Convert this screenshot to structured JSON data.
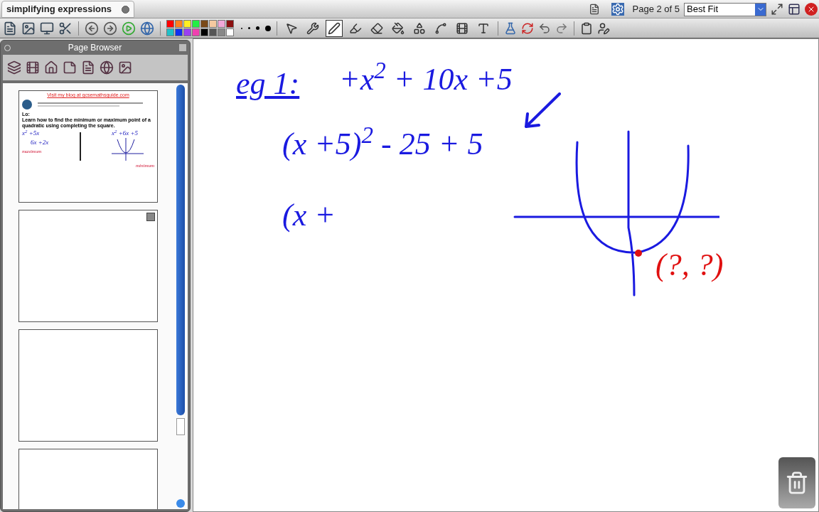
{
  "tab": {
    "title": "simplifying expressions"
  },
  "page_indicator": "Page 2 of 5",
  "zoom": {
    "value": "Best Fit"
  },
  "palette": [
    {
      "color": "#ff0000"
    },
    {
      "color": "#ff7f1e"
    },
    {
      "color": "#ffee22"
    },
    {
      "color": "#22ee44"
    },
    {
      "color": "#7a4a1a"
    },
    {
      "color": "#f5c9a0"
    },
    {
      "color": "#f0a8d8"
    },
    {
      "color": "#8b1010"
    },
    {
      "color": "#20c0c8"
    },
    {
      "color": "#1030f0"
    },
    {
      "color": "#9a40f0"
    },
    {
      "color": "#f040b0"
    },
    {
      "color": "#000000"
    },
    {
      "color": "#555555"
    },
    {
      "color": "#888888"
    },
    {
      "color": "#ffffff"
    }
  ],
  "tools": [
    {
      "selected": false
    },
    {
      "selected": false
    },
    {
      "selected": true
    },
    {
      "selected": false
    },
    {
      "selected": false
    },
    {
      "selected": false
    },
    {
      "selected": false
    },
    {
      "selected": false
    },
    {
      "selected": false
    },
    {
      "selected": false
    }
  ],
  "page_browser": {
    "title": "Page Browser",
    "pages": [
      {
        "kind": "content",
        "link": "Visit my blog at gcsemathsguide.com",
        "heading": "Lo:",
        "objective": "Learn how to find the minimum or maximum point of a quadratic using completing the square.",
        "left_note": "x$^{2}$ +5x",
        "right_note": "x$^{2}$ +6x +5",
        "middle_note": "6x +2x",
        "max_label": "maximum",
        "min_label": "minimum"
      },
      {
        "kind": "blank"
      },
      {
        "kind": "blank"
      },
      {
        "kind": "blank"
      }
    ]
  },
  "canvas": {
    "heading": "eg 1:",
    "expression": "+x$^{2}$ + 10x +5",
    "steps": [
      "(x +5)$^{2}$ - 25 + 5",
      "(x +"
    ],
    "point_label": "(?, ?)"
  }
}
